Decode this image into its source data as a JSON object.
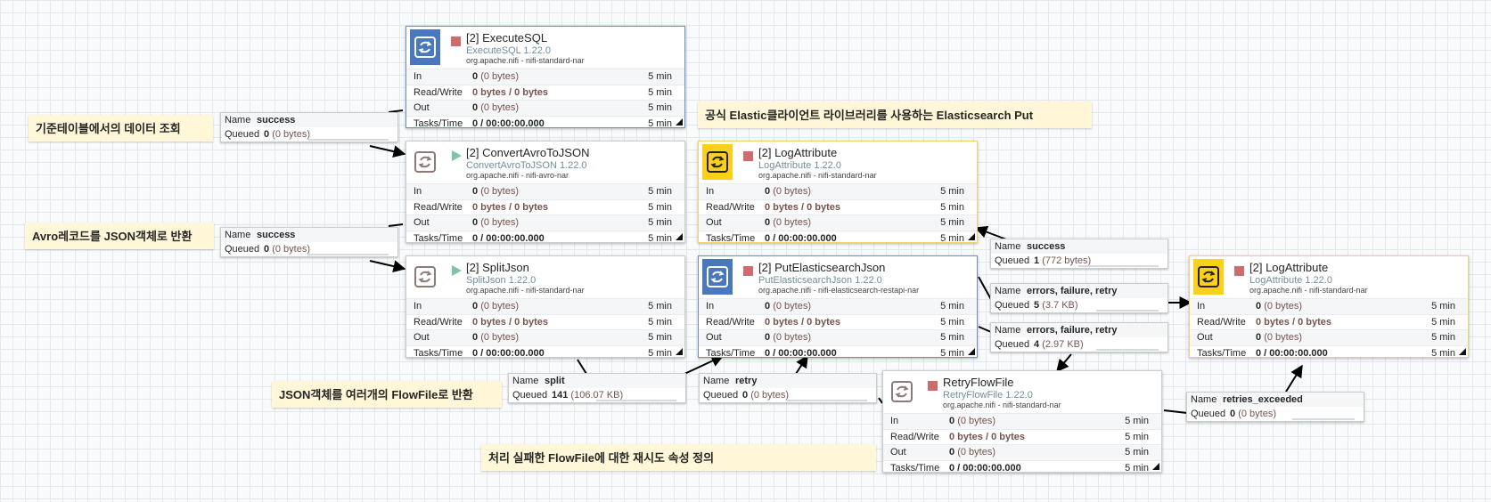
{
  "processors": [
    {
      "id": "p1",
      "name": "[2] ExecuteSQL",
      "type": "ExecuteSQL 1.22.0",
      "bundle": "org.apache.nifi - nifi-standard-nar",
      "icon": "processor-icon",
      "icon_style": "blue",
      "status": "stopped",
      "stats": {
        "in_label": "In",
        "in": "0",
        "in_bytes": "(0 bytes)",
        "rw_label": "Read/Write",
        "rw": "0 bytes / 0 bytes",
        "out_label": "Out",
        "out": "0",
        "out_bytes": "(0 bytes)",
        "tasks_label": "Tasks/Time",
        "tasks": "0 / 00:00:00.000",
        "window": "5 min"
      }
    },
    {
      "id": "p2",
      "name": "[2] ConvertAvroToJSON",
      "type": "ConvertAvroToJSON 1.22.0",
      "bundle": "org.apache.nifi - nifi-avro-nar",
      "icon": "processor-icon",
      "icon_style": "plain",
      "status": "running",
      "stats": {
        "in_label": "In",
        "in": "0",
        "in_bytes": "(0 bytes)",
        "rw_label": "Read/Write",
        "rw": "0 bytes / 0 bytes",
        "out_label": "Out",
        "out": "0",
        "out_bytes": "(0 bytes)",
        "tasks_label": "Tasks/Time",
        "tasks": "0 / 00:00:00.000",
        "window": "5 min"
      }
    },
    {
      "id": "p3",
      "name": "[2] SplitJson",
      "type": "SplitJson 1.22.0",
      "bundle": "org.apache.nifi - nifi-standard-nar",
      "icon": "processor-icon",
      "icon_style": "plain",
      "status": "running",
      "stats": {
        "in_label": "In",
        "in": "0",
        "in_bytes": "(0 bytes)",
        "rw_label": "Read/Write",
        "rw": "0 bytes / 0 bytes",
        "out_label": "Out",
        "out": "0",
        "out_bytes": "(0 bytes)",
        "tasks_label": "Tasks/Time",
        "tasks": "0 / 00:00:00.000",
        "window": "5 min"
      }
    },
    {
      "id": "p4",
      "name": "[2] LogAttribute",
      "type": "LogAttribute 1.22.0",
      "bundle": "org.apache.nifi - nifi-standard-nar",
      "icon": "processor-icon",
      "icon_style": "yellow",
      "status": "stopped",
      "stats": {
        "in_label": "In",
        "in": "0",
        "in_bytes": "(0 bytes)",
        "rw_label": "Read/Write",
        "rw": "0 bytes / 0 bytes",
        "out_label": "Out",
        "out": "0",
        "out_bytes": "(0 bytes)",
        "tasks_label": "Tasks/Time",
        "tasks": "0 / 00:00:00.000",
        "window": "5 min"
      }
    },
    {
      "id": "p5",
      "name": "[2] PutElasticsearchJson",
      "type": "PutElasticsearchJson 1.22.0",
      "bundle": "org.apache.nifi - nifi-elasticsearch-restapi-nar",
      "icon": "processor-icon",
      "icon_style": "blue",
      "status": "stopped",
      "stats": {
        "in_label": "In",
        "in": "0",
        "in_bytes": "(0 bytes)",
        "rw_label": "Read/Write",
        "rw": "0 bytes / 0 bytes",
        "out_label": "Out",
        "out": "0",
        "out_bytes": "(0 bytes)",
        "tasks_label": "Tasks/Time",
        "tasks": "0 / 00:00:00.000",
        "window": "5 min"
      }
    },
    {
      "id": "p6",
      "name": "RetryFlowFile",
      "type": "RetryFlowFile 1.22.0",
      "bundle": "org.apache.nifi - nifi-standard-nar",
      "icon": "processor-icon",
      "icon_style": "plain",
      "status": "stopped",
      "stats": {
        "in_label": "In",
        "in": "0",
        "in_bytes": "(0 bytes)",
        "rw_label": "Read/Write",
        "rw": "0 bytes / 0 bytes",
        "out_label": "Out",
        "out": "0",
        "out_bytes": "(0 bytes)",
        "tasks_label": "Tasks/Time",
        "tasks": "0 / 00:00:00.000",
        "window": "5 min"
      }
    },
    {
      "id": "p7",
      "name": "[2] LogAttribute",
      "type": "LogAttribute 1.22.0",
      "bundle": "org.apache.nifi - nifi-standard-nar",
      "icon": "processor-icon",
      "icon_style": "yellow",
      "status": "stopped",
      "stats": {
        "in_label": "In",
        "in": "0",
        "in_bytes": "(0 bytes)",
        "rw_label": "Read/Write",
        "rw": "0 bytes / 0 bytes",
        "out_label": "Out",
        "out": "0",
        "out_bytes": "(0 bytes)",
        "tasks_label": "Tasks/Time",
        "tasks": "0 / 00:00:00.000",
        "window": "5 min"
      }
    }
  ],
  "connections": [
    {
      "id": "c1",
      "name_label": "Name",
      "name": "success",
      "queued_label": "Queued",
      "count": "0",
      "bytes": "(0 bytes)"
    },
    {
      "id": "c2",
      "name_label": "Name",
      "name": "success",
      "queued_label": "Queued",
      "count": "0",
      "bytes": "(0 bytes)"
    },
    {
      "id": "c3",
      "name_label": "Name",
      "name": "split",
      "queued_label": "Queued",
      "count": "141",
      "bytes": "(106.07 KB)"
    },
    {
      "id": "c4",
      "name_label": "Name",
      "name": "success",
      "queued_label": "Queued",
      "count": "1",
      "bytes": "(772 bytes)"
    },
    {
      "id": "c5",
      "name_label": "Name",
      "name": "errors, failure, retry",
      "queued_label": "Queued",
      "count": "5",
      "bytes": "(3.7 KB)"
    },
    {
      "id": "c6",
      "name_label": "Name",
      "name": "errors, failure, retry",
      "queued_label": "Queued",
      "count": "4",
      "bytes": "(2.97 KB)"
    },
    {
      "id": "c7",
      "name_label": "Name",
      "name": "retry",
      "queued_label": "Queued",
      "count": "0",
      "bytes": "(0 bytes)"
    },
    {
      "id": "c8",
      "name_label": "Name",
      "name": "retries_exceeded",
      "queued_label": "Queued",
      "count": "0",
      "bytes": "(0 bytes)"
    }
  ],
  "labels": [
    {
      "text": "기준테이블에서의 데이터 조회"
    },
    {
      "text": "Avro레코드를 JSON객체로 반환"
    },
    {
      "text": "JSON객체를 여러개의 FlowFile로 반환"
    },
    {
      "text": "공식 Elastic클라이언트 라이브러리를 사용하는 Elasticsearch Put"
    },
    {
      "text": "처리 실패한 FlowFile에 대한 재시도 속성 정의"
    }
  ]
}
